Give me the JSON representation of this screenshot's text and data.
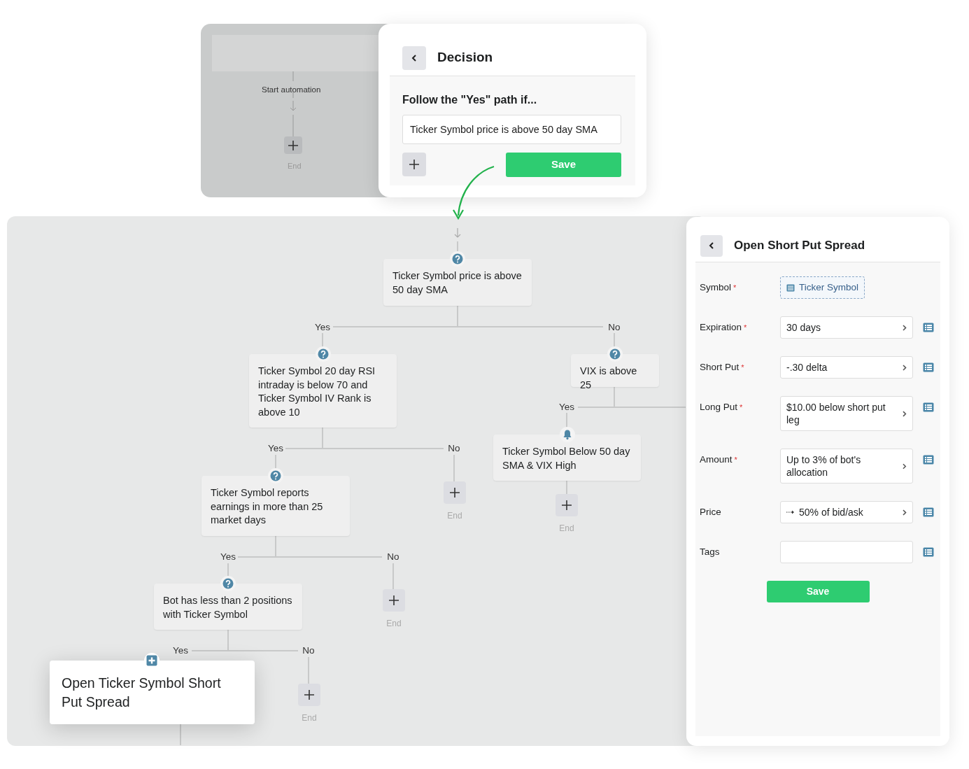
{
  "background_flow": {
    "start_label": "Start automation",
    "end_label": "End"
  },
  "decision_panel": {
    "title": "Decision",
    "prompt": "Follow the \"Yes\" path if...",
    "condition": "Ticker Symbol price is above 50 day SMA",
    "save_label": "Save"
  },
  "flow": {
    "nodes": [
      {
        "kind": "decision",
        "text": "Ticker Symbol price is above 50 day SMA"
      },
      {
        "kind": "decision",
        "text": "Ticker Symbol 20 day RSI intraday is below 70 and Ticker Symbol IV Rank is above 10"
      },
      {
        "kind": "decision",
        "text": "VIX is above 25"
      },
      {
        "kind": "alert",
        "text": "Ticker Symbol Below 50 day SMA & VIX High"
      },
      {
        "kind": "decision",
        "text": "Ticker Symbol reports earnings in more than 25 market days"
      },
      {
        "kind": "decision",
        "text": "Bot has less than 2 positions with Ticker Symbol"
      },
      {
        "kind": "action",
        "text": "Open Ticker Symbol Short Put Spread"
      }
    ],
    "branch_labels": [
      "Yes",
      "No",
      "Yes",
      "No",
      "Yes",
      "Yes",
      "No",
      "Yes",
      "No"
    ],
    "end_labels": [
      "End",
      "End",
      "End",
      "End"
    ]
  },
  "action_panel": {
    "title": "Open Short Put Spread",
    "fields": [
      {
        "kind": "token",
        "label": "Symbol",
        "required_mark": "*",
        "value": "Ticker Symbol"
      },
      {
        "kind": "select",
        "label": "Expiration",
        "required_mark": "*",
        "value": "30 days"
      },
      {
        "kind": "select",
        "label": "Short Put",
        "required_mark": "*",
        "value": "-.30 delta"
      },
      {
        "kind": "select",
        "label": "Long Put",
        "required_mark": "*",
        "value": "$10.00 below short put leg"
      },
      {
        "kind": "select",
        "label": "Amount",
        "required_mark": "*",
        "value": "Up to 3% of bot's allocation"
      },
      {
        "kind": "select",
        "label": "Price",
        "value": "50% of bid/ask",
        "prefix_icon": true
      },
      {
        "kind": "text",
        "label": "Tags"
      }
    ],
    "save_label": "Save"
  }
}
